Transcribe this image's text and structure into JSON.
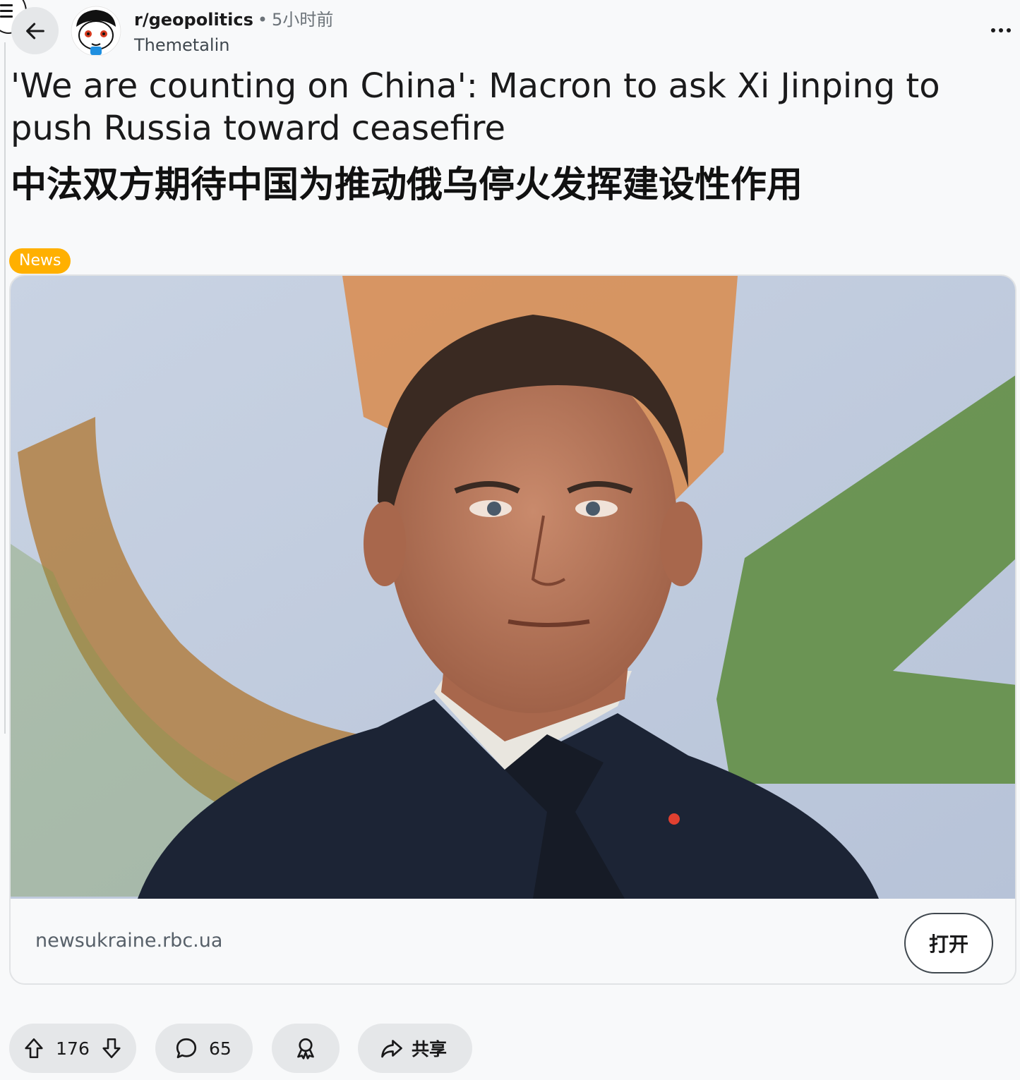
{
  "header": {
    "subreddit": "r/geopolitics",
    "separator": "•",
    "time_ago": "5小时前",
    "author": "Themetalin"
  },
  "post": {
    "title_en": "'We are counting on China': Macron to ask Xi Jinping to push Russia toward ceasefire",
    "title_zh": "中法双方期待中国为推动俄乌停火发挥建设性作用",
    "flair": "News",
    "flair_color": "#ffb000"
  },
  "link_card": {
    "domain": "newsukraine.rbc.ua",
    "open_label": "打开"
  },
  "actions": {
    "upvotes": "176",
    "comments": "65",
    "share_label": "共享"
  },
  "icons": {
    "menu": "menu-icon",
    "back": "arrow-left-icon",
    "more": "more-horizontal-icon",
    "upvote": "arrow-up-icon",
    "downvote": "arrow-down-icon",
    "comment": "comment-bubble-icon",
    "award": "award-icon",
    "share": "share-arrow-icon"
  }
}
